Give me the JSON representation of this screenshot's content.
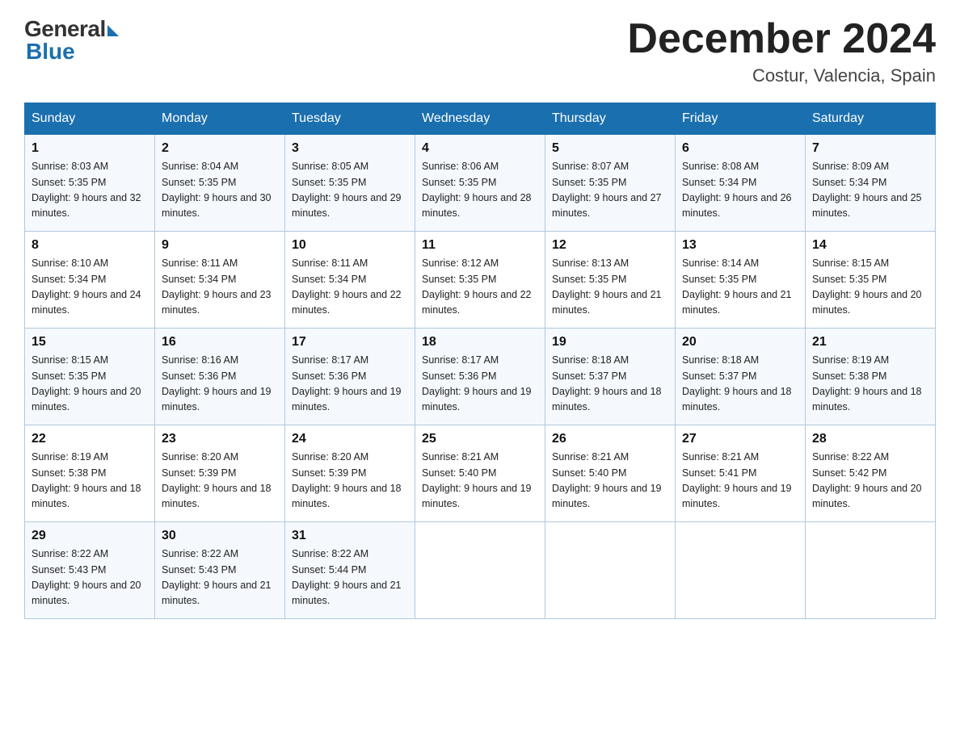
{
  "logo": {
    "general": "General",
    "blue": "Blue"
  },
  "title": "December 2024",
  "location": "Costur, Valencia, Spain",
  "days_of_week": [
    "Sunday",
    "Monday",
    "Tuesday",
    "Wednesday",
    "Thursday",
    "Friday",
    "Saturday"
  ],
  "weeks": [
    [
      {
        "day": "1",
        "sunrise": "8:03 AM",
        "sunset": "5:35 PM",
        "daylight": "9 hours and 32 minutes."
      },
      {
        "day": "2",
        "sunrise": "8:04 AM",
        "sunset": "5:35 PM",
        "daylight": "9 hours and 30 minutes."
      },
      {
        "day": "3",
        "sunrise": "8:05 AM",
        "sunset": "5:35 PM",
        "daylight": "9 hours and 29 minutes."
      },
      {
        "day": "4",
        "sunrise": "8:06 AM",
        "sunset": "5:35 PM",
        "daylight": "9 hours and 28 minutes."
      },
      {
        "day": "5",
        "sunrise": "8:07 AM",
        "sunset": "5:35 PM",
        "daylight": "9 hours and 27 minutes."
      },
      {
        "day": "6",
        "sunrise": "8:08 AM",
        "sunset": "5:34 PM",
        "daylight": "9 hours and 26 minutes."
      },
      {
        "day": "7",
        "sunrise": "8:09 AM",
        "sunset": "5:34 PM",
        "daylight": "9 hours and 25 minutes."
      }
    ],
    [
      {
        "day": "8",
        "sunrise": "8:10 AM",
        "sunset": "5:34 PM",
        "daylight": "9 hours and 24 minutes."
      },
      {
        "day": "9",
        "sunrise": "8:11 AM",
        "sunset": "5:34 PM",
        "daylight": "9 hours and 23 minutes."
      },
      {
        "day": "10",
        "sunrise": "8:11 AM",
        "sunset": "5:34 PM",
        "daylight": "9 hours and 22 minutes."
      },
      {
        "day": "11",
        "sunrise": "8:12 AM",
        "sunset": "5:35 PM",
        "daylight": "9 hours and 22 minutes."
      },
      {
        "day": "12",
        "sunrise": "8:13 AM",
        "sunset": "5:35 PM",
        "daylight": "9 hours and 21 minutes."
      },
      {
        "day": "13",
        "sunrise": "8:14 AM",
        "sunset": "5:35 PM",
        "daylight": "9 hours and 21 minutes."
      },
      {
        "day": "14",
        "sunrise": "8:15 AM",
        "sunset": "5:35 PM",
        "daylight": "9 hours and 20 minutes."
      }
    ],
    [
      {
        "day": "15",
        "sunrise": "8:15 AM",
        "sunset": "5:35 PM",
        "daylight": "9 hours and 20 minutes."
      },
      {
        "day": "16",
        "sunrise": "8:16 AM",
        "sunset": "5:36 PM",
        "daylight": "9 hours and 19 minutes."
      },
      {
        "day": "17",
        "sunrise": "8:17 AM",
        "sunset": "5:36 PM",
        "daylight": "9 hours and 19 minutes."
      },
      {
        "day": "18",
        "sunrise": "8:17 AM",
        "sunset": "5:36 PM",
        "daylight": "9 hours and 19 minutes."
      },
      {
        "day": "19",
        "sunrise": "8:18 AM",
        "sunset": "5:37 PM",
        "daylight": "9 hours and 18 minutes."
      },
      {
        "day": "20",
        "sunrise": "8:18 AM",
        "sunset": "5:37 PM",
        "daylight": "9 hours and 18 minutes."
      },
      {
        "day": "21",
        "sunrise": "8:19 AM",
        "sunset": "5:38 PM",
        "daylight": "9 hours and 18 minutes."
      }
    ],
    [
      {
        "day": "22",
        "sunrise": "8:19 AM",
        "sunset": "5:38 PM",
        "daylight": "9 hours and 18 minutes."
      },
      {
        "day": "23",
        "sunrise": "8:20 AM",
        "sunset": "5:39 PM",
        "daylight": "9 hours and 18 minutes."
      },
      {
        "day": "24",
        "sunrise": "8:20 AM",
        "sunset": "5:39 PM",
        "daylight": "9 hours and 18 minutes."
      },
      {
        "day": "25",
        "sunrise": "8:21 AM",
        "sunset": "5:40 PM",
        "daylight": "9 hours and 19 minutes."
      },
      {
        "day": "26",
        "sunrise": "8:21 AM",
        "sunset": "5:40 PM",
        "daylight": "9 hours and 19 minutes."
      },
      {
        "day": "27",
        "sunrise": "8:21 AM",
        "sunset": "5:41 PM",
        "daylight": "9 hours and 19 minutes."
      },
      {
        "day": "28",
        "sunrise": "8:22 AM",
        "sunset": "5:42 PM",
        "daylight": "9 hours and 20 minutes."
      }
    ],
    [
      {
        "day": "29",
        "sunrise": "8:22 AM",
        "sunset": "5:43 PM",
        "daylight": "9 hours and 20 minutes."
      },
      {
        "day": "30",
        "sunrise": "8:22 AM",
        "sunset": "5:43 PM",
        "daylight": "9 hours and 21 minutes."
      },
      {
        "day": "31",
        "sunrise": "8:22 AM",
        "sunset": "5:44 PM",
        "daylight": "9 hours and 21 minutes."
      },
      null,
      null,
      null,
      null
    ]
  ]
}
